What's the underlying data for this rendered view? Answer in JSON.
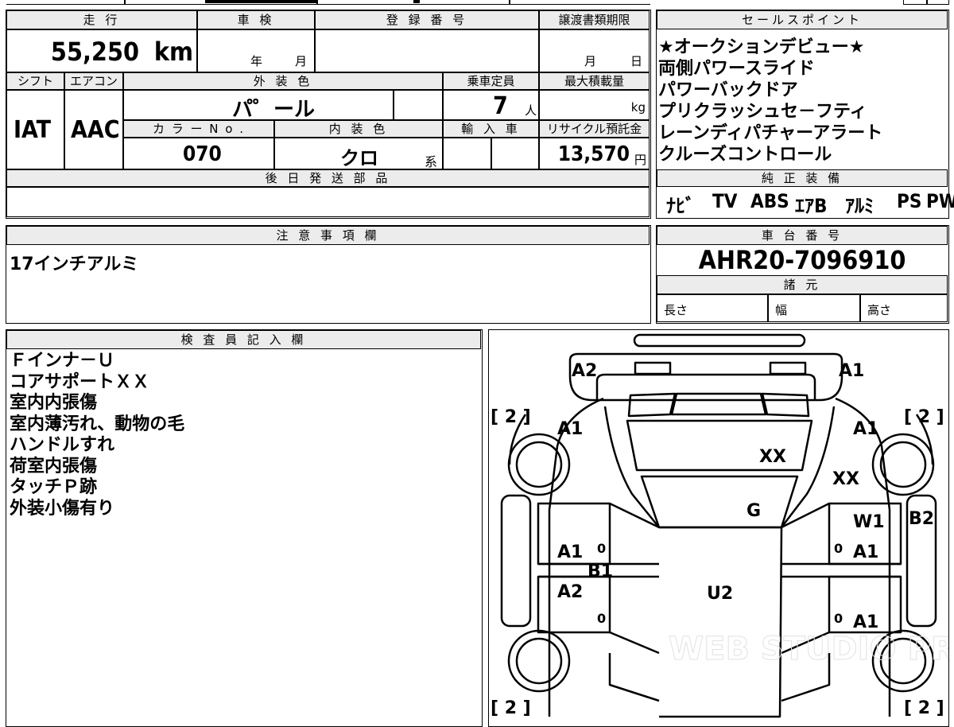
{
  "header": {
    "mileage_label": "走 行",
    "mileage_value": "55,250",
    "mileage_unit": "km",
    "inspection_label": "車 検",
    "inspection_year": "年",
    "inspection_month": "月",
    "registration_label": "登 録 番 号",
    "transfer_deadline_label": "譲渡書類期限",
    "transfer_month": "月",
    "transfer_day": "日"
  },
  "specs": {
    "shift_label": "シフト",
    "shift_value": "IAT",
    "aircon_label": "エアコン",
    "aircon_value": "AAC",
    "exterior_color_label": "外 装 色",
    "exterior_color_value": "パ゜ール",
    "capacity_label": "乗車定員",
    "capacity_value": "7",
    "capacity_unit": "人",
    "max_load_label": "最大積載量",
    "max_load_unit": "kg",
    "color_no_label": "カ ラ ー N o .",
    "color_no_value": "070",
    "interior_color_label": "内 装 色",
    "interior_color_value": "クロ",
    "interior_color_suffix": "系",
    "import_label": "輸 入 車",
    "recycle_label": "リサイクル預託金",
    "recycle_value": "13,570",
    "recycle_unit": "円",
    "later_parts_label": "後 日 発 送 部 品"
  },
  "sales_points": {
    "label": "セールスポイント",
    "items": [
      "★オークションデビュー★",
      "両側パワースライド",
      "パワーバックドア",
      "プリクラッシュセ－フティ",
      "レーンディパチャーアラート",
      "クルーズコントロール"
    ]
  },
  "equipment": {
    "label": "純 正 装 備",
    "items": [
      "ﾅﾋﾞ",
      "TV",
      "ABS",
      "ｴｱB",
      "ｱﾙﾐ",
      "PS",
      "PW"
    ]
  },
  "notes": {
    "label": "注 意 事 項 欄",
    "text": "17インチアルミ"
  },
  "chassis": {
    "label": "車 台 番 号",
    "value": "AHR20-7096910",
    "dims_label": "諸 元",
    "length_label": "長さ",
    "width_label": "幅",
    "height_label": "高さ"
  },
  "inspector": {
    "label": "検 査 員 記 入 欄",
    "lines": [
      "Ｆインナ－Ｕ",
      "コアサポートＸＸ",
      "室内内張傷",
      "室内薄汚れ、動物の毛",
      "ハンドルすれ",
      "荷室内張傷",
      "タッチＰ跡",
      "外装小傷有り"
    ]
  },
  "diagram": {
    "tire_label": "[ 2 ]",
    "marks": {
      "front_left_corner": "A2",
      "front_right_corner": "A1",
      "left_front_fender": "A1",
      "right_front_fender": "A1",
      "hood": "XX",
      "core_support": "XX",
      "windshield": "G",
      "right_mirror": "W1",
      "right_step": "B2",
      "left_front_door": "A1",
      "left_pillar": "B1",
      "left_rear_door": "A2",
      "roof": "U2",
      "right_front_door": "A1",
      "right_rear_door": "A1",
      "door_marker": "0"
    },
    "watermark": "WEB STUDIO PRO"
  }
}
